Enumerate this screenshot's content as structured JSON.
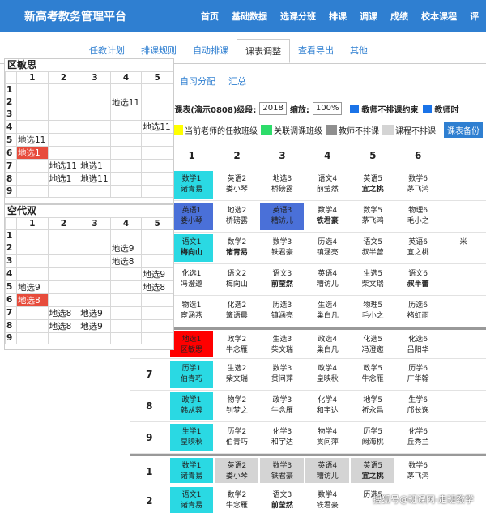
{
  "header": {
    "title": "新高考教务管理平台",
    "nav": [
      "首页",
      "基础数据",
      "选课分班",
      "排课",
      "调课",
      "成绩",
      "校本课程",
      "评"
    ]
  },
  "tabs": [
    "任教计划",
    "排课规则",
    "自动排课",
    "课表调整",
    "查看导出",
    "其他"
  ],
  "subtabs": [
    "自习分配",
    "汇总"
  ],
  "toolbar": {
    "label": "l课表(演示0808)",
    "grade_label": "级段:",
    "grade": "2018",
    "zoom_label": "缩放:",
    "zoom": "100%",
    "opt1": "教师不排课约束",
    "opt2": "教师时"
  },
  "legend": {
    "items": [
      "当前老师的任教班级",
      "关联调课班级",
      "教师不排课",
      "课程不排课"
    ],
    "colors": [
      "#ffff00",
      "#2ddc6a",
      "#8f8f8f",
      "#d4d4d4"
    ],
    "button": "课表备份"
  },
  "grid": {
    "cols": [
      "1",
      "2",
      "3",
      "4",
      "5",
      "6",
      ""
    ],
    "rows": [
      {
        "h": "",
        "cells": [
          [
            "数学1",
            "诸青易",
            "cyan"
          ],
          [
            "英语2",
            "娄小琴",
            ""
          ],
          [
            "地选3",
            "桥磅露",
            ""
          ],
          [
            "语文4",
            "前莹然",
            ""
          ],
          [
            "英语5",
            "宜之桃",
            "bold"
          ],
          [
            "数学6",
            "茅飞鸿",
            ""
          ],
          [
            "",
            "",
            " "
          ]
        ]
      },
      {
        "h": "",
        "cells": [
          [
            "英语1",
            "娄小琴",
            "blue"
          ],
          [
            "地选2",
            "桥磅露",
            ""
          ],
          [
            "英语3",
            "糟访儿",
            "blue"
          ],
          [
            "数学4",
            "铁君豪",
            "bold"
          ],
          [
            "数学5",
            "茅飞鸿",
            ""
          ],
          [
            "物理6",
            "毛小之",
            ""
          ],
          [
            "",
            "",
            " "
          ]
        ]
      },
      {
        "h": "",
        "cells": [
          [
            "语文1",
            "梅向山",
            "cyanb"
          ],
          [
            "数学2",
            "诸青易",
            "bold"
          ],
          [
            "数学3",
            "铁君豪",
            ""
          ],
          [
            "历选4",
            "镇涵亮",
            ""
          ],
          [
            "语文5",
            "叔半蕾",
            ""
          ],
          [
            "英语6",
            "宜之桃",
            ""
          ],
          [
            "",
            "米",
            ""
          ]
        ]
      },
      {
        "h": "",
        "cells": [
          [
            "化选1",
            "冯澄邀",
            ""
          ],
          [
            "语文2",
            "梅向山",
            ""
          ],
          [
            "语文3",
            "前莹然",
            "bold"
          ],
          [
            "英语4",
            "糟访儿",
            ""
          ],
          [
            "生选5",
            "柴文瑞",
            ""
          ],
          [
            "语文6",
            "叔半蕾",
            "bold"
          ],
          [
            "",
            "",
            " "
          ]
        ]
      },
      {
        "h": "",
        "cells": [
          [
            "物选1",
            "宦涵燕",
            ""
          ],
          [
            "化选2",
            "篝语晨",
            ""
          ],
          [
            "历选3",
            "镇涵亮",
            ""
          ],
          [
            "生选4",
            "巢白凡",
            ""
          ],
          [
            "物理5",
            "毛小之",
            ""
          ],
          [
            "历选6",
            "褚虹雨",
            ""
          ],
          [
            "",
            "",
            " "
          ]
        ]
      },
      {
        "h": "",
        "sep": true,
        "cells": [
          [
            "地选1",
            "区敏思",
            "red"
          ],
          [
            "政学2",
            "牛念雁",
            ""
          ],
          [
            "生选3",
            "柴文瑞",
            ""
          ],
          [
            "政选4",
            "巢白凡",
            ""
          ],
          [
            "化选5",
            "冯澄邀",
            ""
          ],
          [
            "化选6",
            "吕阳华",
            ""
          ],
          [
            "",
            "",
            " "
          ]
        ]
      },
      {
        "h": "7",
        "cells": [
          [
            "历学1",
            "伯青巧",
            "cyan"
          ],
          [
            "生选2",
            "柴文瑞",
            ""
          ],
          [
            "数学3",
            "贯问萍",
            ""
          ],
          [
            "政学4",
            "皇映秋",
            ""
          ],
          [
            "政学5",
            "牛念雁",
            ""
          ],
          [
            "历学6",
            "广华翰",
            ""
          ],
          [
            "",
            "",
            " "
          ]
        ]
      },
      {
        "h": "8",
        "cells": [
          [
            "政学1",
            "韩从蓉",
            "cyan"
          ],
          [
            "物学2",
            "钊梦之",
            ""
          ],
          [
            "政学3",
            "牛念雁",
            ""
          ],
          [
            "化学4",
            "和宇达",
            ""
          ],
          [
            "地学5",
            "祈永昌",
            ""
          ],
          [
            "生学6",
            "邝长逸",
            ""
          ],
          [
            "",
            "",
            " "
          ]
        ]
      },
      {
        "h": "9",
        "cells": [
          [
            "生学1",
            "皇映秋",
            "cyan"
          ],
          [
            "历学2",
            "伯青巧",
            ""
          ],
          [
            "化学3",
            "和宇达",
            ""
          ],
          [
            "物学4",
            "贯问萍",
            ""
          ],
          [
            "历学5",
            "阚海桃",
            ""
          ],
          [
            "化学6",
            "丘秀兰",
            ""
          ],
          [
            "",
            "",
            " "
          ]
        ]
      },
      {
        "h": "1",
        "sep": true,
        "cells": [
          [
            "数学1",
            "诸青易",
            "cyan"
          ],
          [
            "英语2",
            "娄小琴",
            "grey"
          ],
          [
            "数学3",
            "铁君豪",
            "grey"
          ],
          [
            "英语4",
            "糟访儿",
            "grey"
          ],
          [
            "英语5",
            "宜之桃",
            "greyb"
          ],
          [
            "数学6",
            "茅飞鸿",
            ""
          ],
          [
            "",
            "",
            " "
          ]
        ]
      },
      {
        "h": "2",
        "cells": [
          [
            "语文1",
            "诸青易",
            "cyan"
          ],
          [
            "数学2",
            "牛念雁",
            ""
          ],
          [
            "语文3",
            "前莹然",
            "bold"
          ],
          [
            "数学4",
            "铁君豪",
            ""
          ],
          [
            "历选5",
            "",
            ""
          ],
          [
            "",
            "",
            " "
          ],
          [
            "",
            "",
            " "
          ]
        ]
      }
    ]
  },
  "panel1": {
    "title": "区敏思",
    "cols": [
      "1",
      "2",
      "3",
      "4",
      "5"
    ],
    "rows": [
      [
        "1",
        "",
        "",
        "",
        "",
        ""
      ],
      [
        "2",
        "",
        "",
        "",
        "地选11",
        ""
      ],
      [
        "3",
        "",
        "",
        "",
        "",
        ""
      ],
      [
        "4",
        "",
        "",
        "",
        "",
        "地选11"
      ],
      [
        "5",
        "地选11",
        "",
        "",
        "",
        ""
      ],
      [
        "6",
        "地选1",
        "",
        "",
        "",
        ""
      ],
      [
        "7",
        "",
        "地选11",
        "地选1",
        "",
        ""
      ],
      [
        "8",
        "",
        "地选1",
        "地选11",
        "",
        ""
      ],
      [
        "9",
        "",
        "",
        "",
        "",
        ""
      ]
    ]
  },
  "panel2": {
    "title": "空代双",
    "cols": [
      "1",
      "2",
      "3",
      "4",
      "5"
    ],
    "rows": [
      [
        "1",
        "",
        "",
        "",
        "",
        ""
      ],
      [
        "2",
        "",
        "",
        "",
        "地选9",
        ""
      ],
      [
        "3",
        "",
        "",
        "",
        "地选8",
        ""
      ],
      [
        "4",
        "",
        "",
        "",
        "",
        "地选9"
      ],
      [
        "5",
        "地选9",
        "",
        "",
        "",
        "地选8"
      ],
      [
        "6",
        "地选8",
        "",
        "",
        "",
        ""
      ],
      [
        "7",
        "",
        "地选8",
        "地选9",
        "",
        ""
      ],
      [
        "8",
        "",
        "地选8",
        "地选9",
        "",
        ""
      ],
      [
        "9",
        "",
        "",
        "",
        "",
        ""
      ]
    ]
  },
  "watermark": "搜狐号@班课网-走班教学"
}
